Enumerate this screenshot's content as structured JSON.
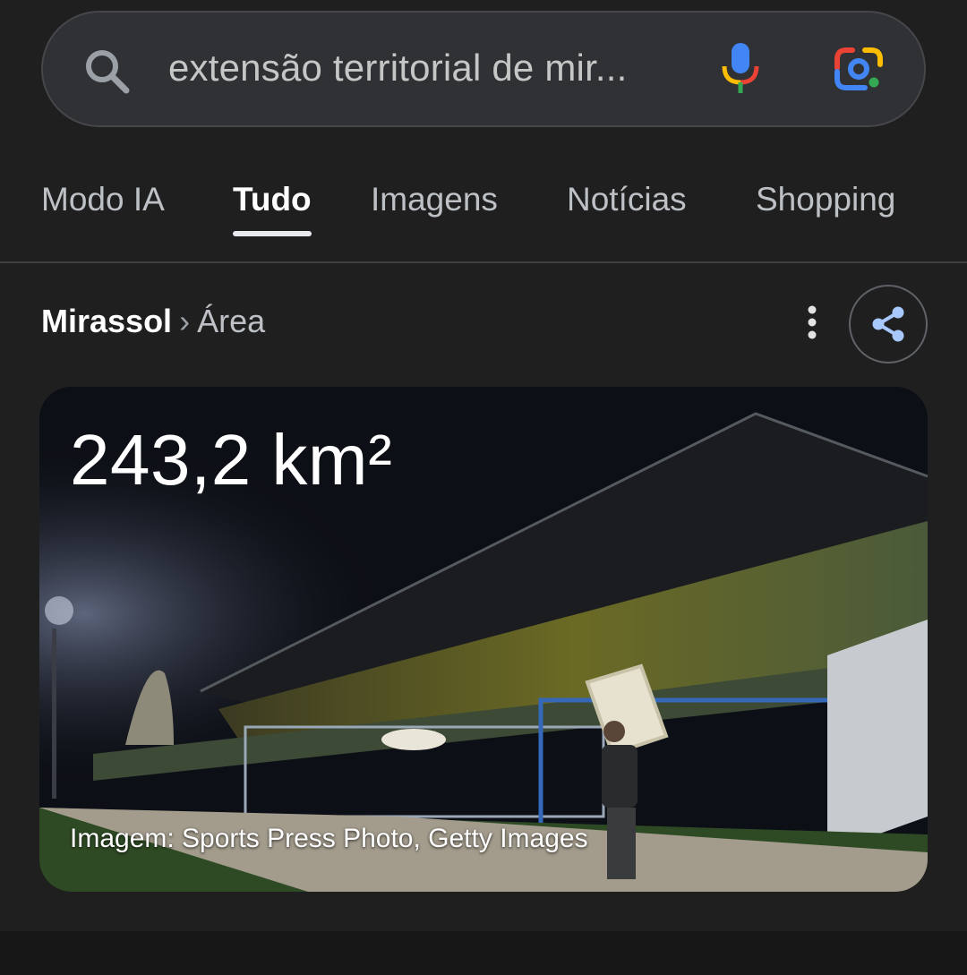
{
  "search": {
    "query": "extensão territorial de mir...",
    "icons": {
      "search": "search-icon",
      "mic": "mic-icon",
      "lens": "google-lens-icon"
    }
  },
  "tabs": [
    {
      "label": "Modo IA",
      "active": false
    },
    {
      "label": "Tudo",
      "active": true
    },
    {
      "label": "Imagens",
      "active": false
    },
    {
      "label": "Notícias",
      "active": false
    },
    {
      "label": "Shopping",
      "active": false
    }
  ],
  "result": {
    "breadcrumb_main": "Mirassol",
    "breadcrumb_separator": "›",
    "breadcrumb_sub": "Área",
    "icons": {
      "more": "more-vert-icon",
      "share": "share-icon"
    }
  },
  "card": {
    "value": "243,2 km²",
    "credit": "Imagem: Sports Press Photo, Getty Images",
    "image_subject": "stadium-grandstand-photo"
  },
  "colors": {
    "background": "#1f1f1f",
    "search_bg": "#303134",
    "active_tab": "#ffffff",
    "share_icon": "#a8c7fa"
  }
}
